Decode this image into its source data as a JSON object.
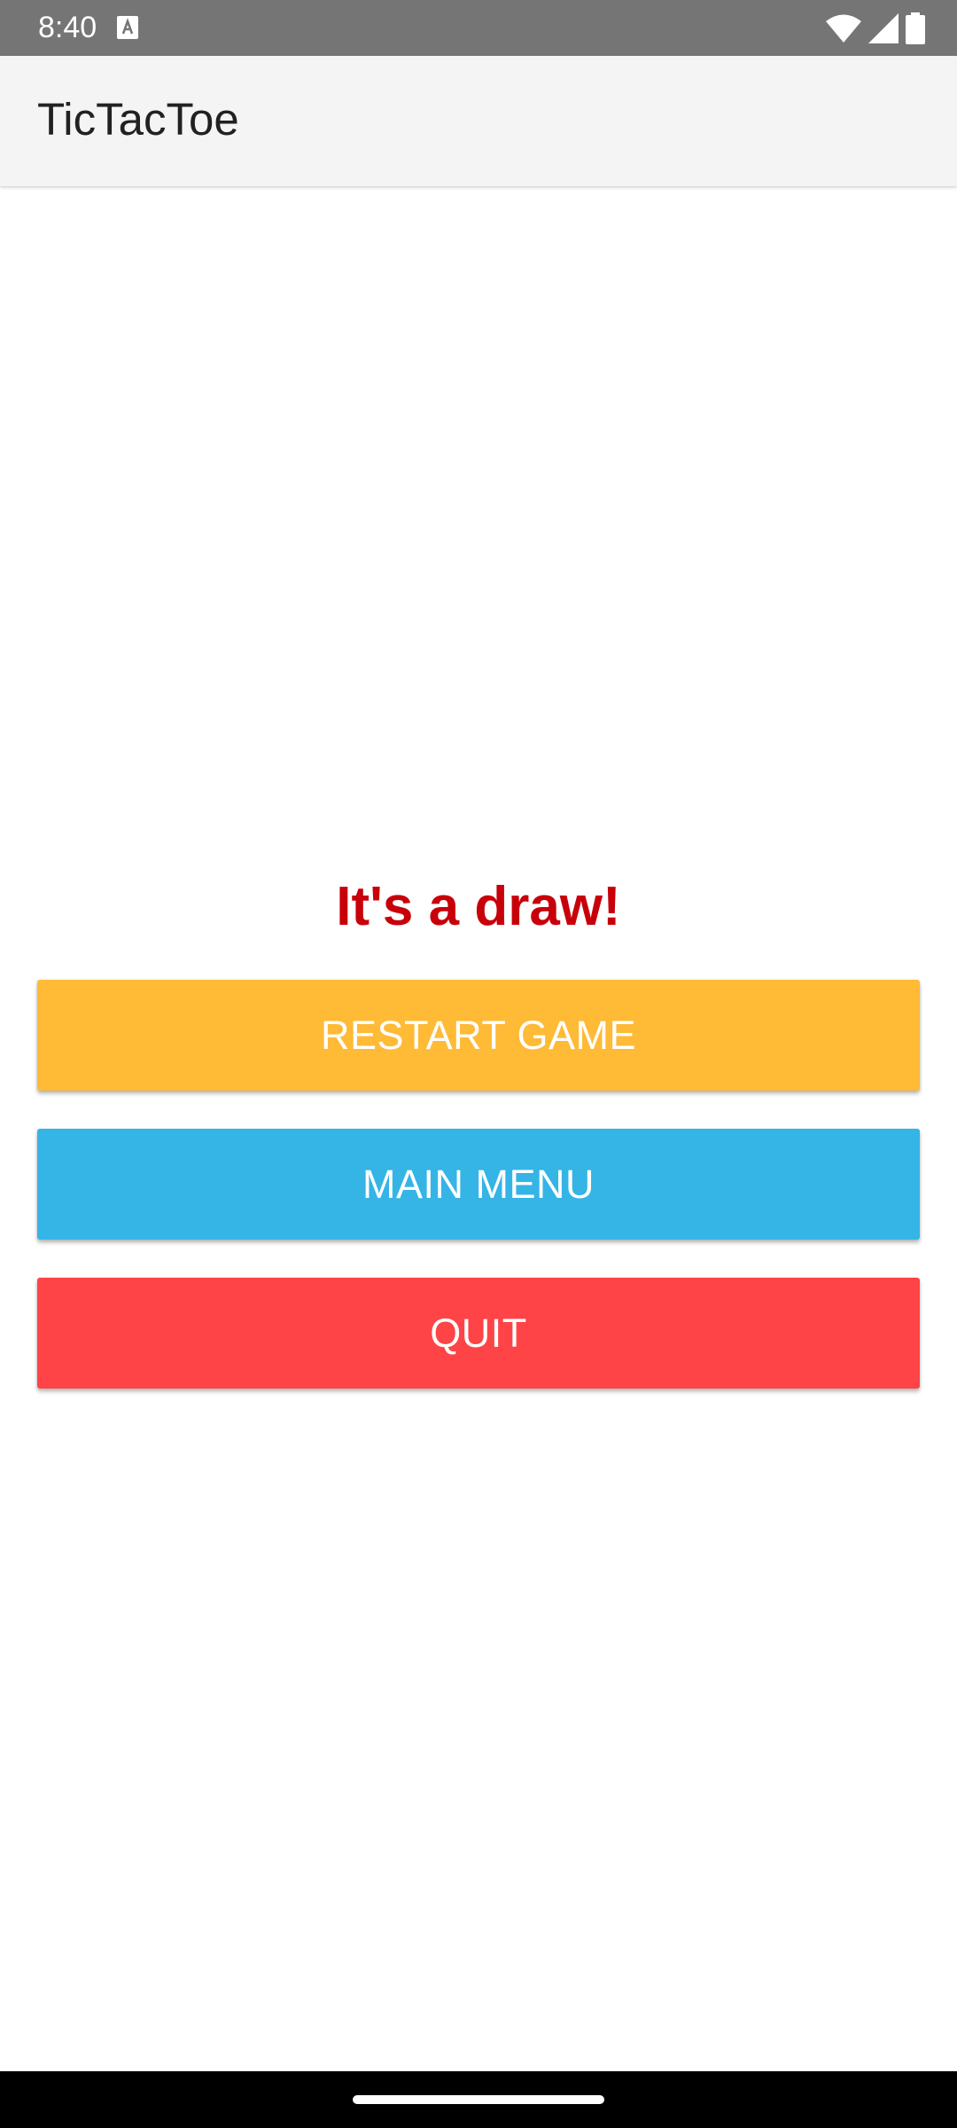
{
  "status_bar": {
    "time": "8:40",
    "notification_icon": "text-a-icon",
    "wifi_icon": "wifi-icon",
    "signal_icon": "signal-icon",
    "battery_icon": "battery-icon"
  },
  "app_bar": {
    "title": "TicTacToe"
  },
  "result": {
    "message": "It's a draw!",
    "color": "#c8000a"
  },
  "buttons": {
    "restart_label": "RESTART GAME",
    "main_menu_label": "MAIN MENU",
    "quit_label": "QUIT",
    "restart_color": "#ffba36",
    "main_menu_color": "#35b4e6",
    "quit_color": "#fe4446"
  },
  "colors": {
    "status_bar": "#757575",
    "app_bar": "#f4f4f4",
    "nav_bar": "#000000"
  }
}
